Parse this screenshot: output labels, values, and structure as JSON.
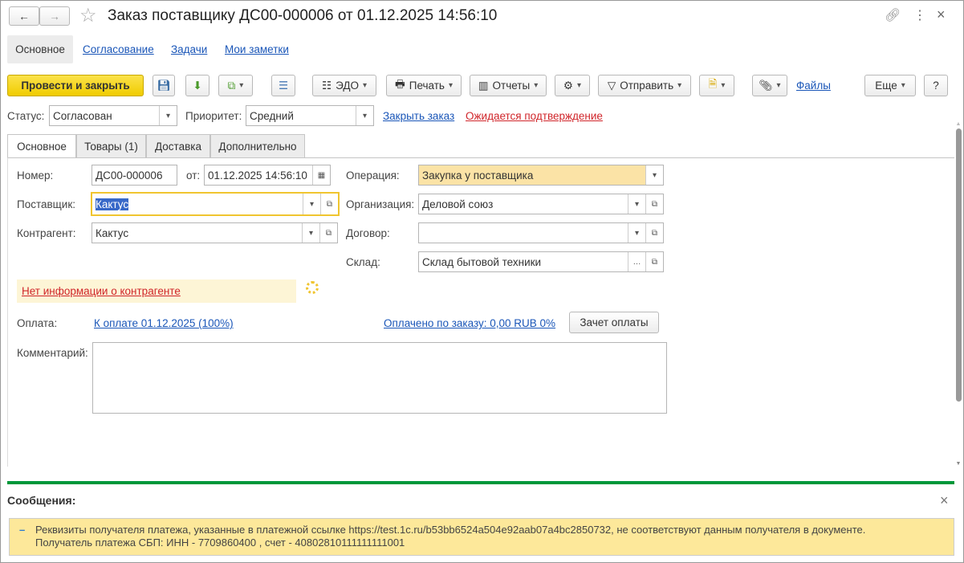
{
  "window": {
    "title": "Заказ поставщику ДС00-000006 от 01.12.2025 14:56:10"
  },
  "nav_tabs": [
    "Основное",
    "Согласование",
    "Задачи",
    "Мои заметки"
  ],
  "toolbar": {
    "post_close": "Провести и закрыть",
    "edo": "ЭДО",
    "print": "Печать",
    "reports": "Отчеты",
    "send": "Отправить",
    "files": "Файлы",
    "more": "Еще",
    "help": "?"
  },
  "status": {
    "status_label": "Статус:",
    "status_value": "Согласован",
    "priority_label": "Приоритет:",
    "priority_value": "Средний",
    "close_order": "Закрыть заказ",
    "awaiting": "Ожидается подтверждение"
  },
  "form_tabs": [
    "Основное",
    "Товары (1)",
    "Доставка",
    "Дополнительно"
  ],
  "form": {
    "number_label": "Номер:",
    "number": "ДС00-000006",
    "from_label": "от:",
    "date": "01.12.2025 14:56:10",
    "supplier_label": "Поставщик:",
    "supplier": "Кактус",
    "counterparty_label": "Контрагент:",
    "counterparty": "Кактус",
    "operation_label": "Операция:",
    "operation": "Закупка у поставщика",
    "organization_label": "Организация:",
    "organization": "Деловой союз",
    "contract_label": "Договор:",
    "contract": "",
    "warehouse_label": "Склад:",
    "warehouse": "Склад бытовой техники",
    "no_info": "Нет информации о контрагенте",
    "payment_label": "Оплата:",
    "payment_link": "К оплате 01.12.2025 (100%)",
    "paid_link": "Оплачено по заказу: 0,00 RUB 0%",
    "offset_button": "Зачет оплаты",
    "comment_label": "Комментарий:",
    "comment": ""
  },
  "messages": {
    "title": "Сообщения:",
    "close": "×",
    "line1": "Реквизиты получателя платежа, указанные в платежной ссылке https://test.1c.ru/b53bb6524a504e92aab07a4bc2850732, не соответствуют данным получателя в документе.",
    "line2": "Получатель платежа СБП: ИНН - 7709860400 , счет - 40802810111111111001"
  },
  "colors": {
    "accent_yellow": "#f5d417",
    "link": "#1a56b8",
    "warning_red": "#d0252a",
    "green_bar": "#00973a",
    "message_bg": "#fde89a"
  }
}
